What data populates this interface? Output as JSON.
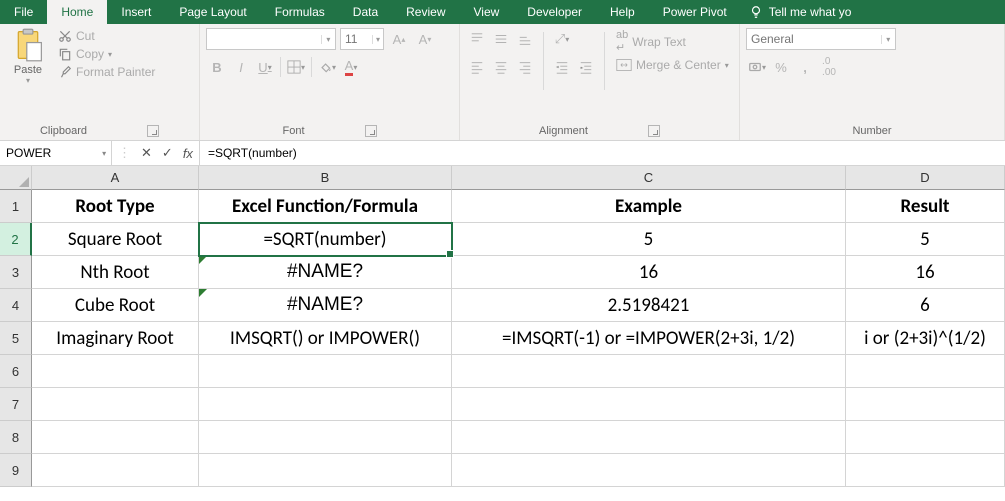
{
  "tabs": [
    "File",
    "Home",
    "Insert",
    "Page Layout",
    "Formulas",
    "Data",
    "Review",
    "View",
    "Developer",
    "Help",
    "Power Pivot"
  ],
  "active_tab": "Home",
  "tellme": "Tell me what yo",
  "ribbon": {
    "clipboard": {
      "label": "Clipboard",
      "paste": "Paste",
      "cut": "Cut",
      "copy": "Copy",
      "painter": "Format Painter"
    },
    "font": {
      "label": "Font",
      "name_ph": "",
      "size_ph": "11"
    },
    "alignment": {
      "label": "Alignment",
      "wrap": "Wrap Text",
      "merge": "Merge & Center"
    },
    "number": {
      "label": "Number",
      "format": "General"
    }
  },
  "namebox": "POWER",
  "formula": "=SQRT(number)",
  "columns": [
    "A",
    "B",
    "C",
    "D"
  ],
  "rows": [
    "1",
    "2",
    "3",
    "4",
    "5",
    "6",
    "7",
    "8",
    "9"
  ],
  "active_row": "2",
  "grid": {
    "r1": {
      "a": "Root Type",
      "b": "Excel Function/Formula",
      "c": "Example",
      "d": "Result"
    },
    "r2": {
      "a": "Square Root",
      "b": "=SQRT(number)",
      "c": "5",
      "d": "5"
    },
    "r3": {
      "a": "Nth Root",
      "b": "#NAME?",
      "c": "16",
      "d": "16"
    },
    "r4": {
      "a": "Cube Root",
      "b": "#NAME?",
      "c": "2.5198421",
      "d": "6"
    },
    "r5": {
      "a": "Imaginary Root",
      "b": "IMSQRT() or IMPOWER()",
      "c": "=IMSQRT(-1) or =IMPOWER(2+3i, 1/2)",
      "d": "i or (2+3i)^(1/2)"
    }
  }
}
